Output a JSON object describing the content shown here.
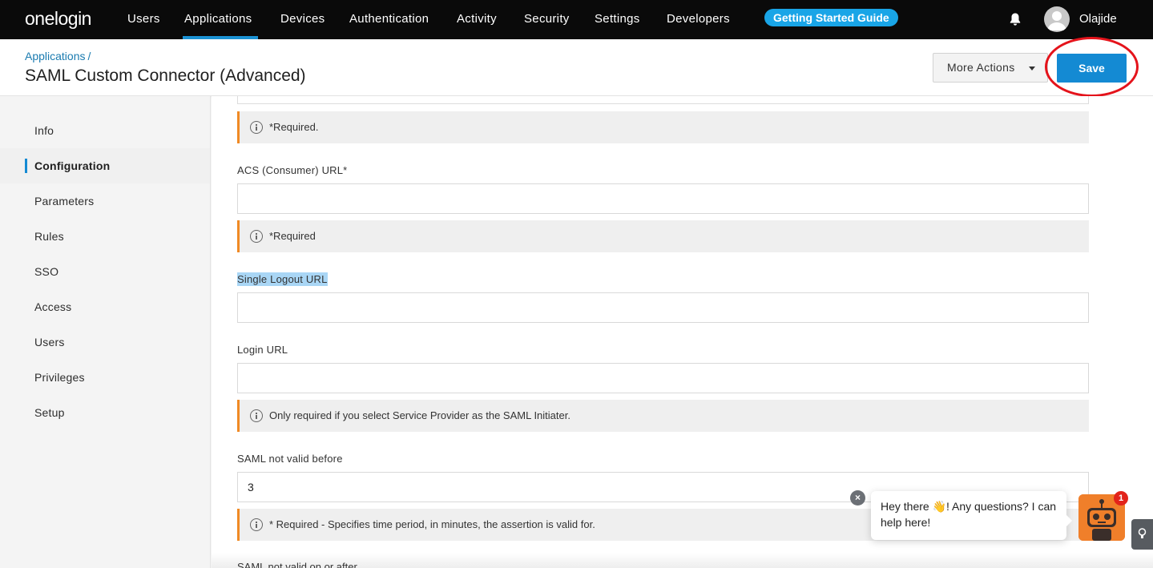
{
  "topnav": {
    "logo": "onelogin",
    "items": [
      "Users",
      "Applications",
      "Devices",
      "Authentication",
      "Activity",
      "Security",
      "Settings",
      "Developers"
    ],
    "active": "Applications",
    "guide_label": "Getting Started Guide",
    "username": "Olajide"
  },
  "header": {
    "breadcrumb": "Applications",
    "breadcrumb_sep": "/",
    "title": "SAML Custom Connector (Advanced)",
    "more_actions": "More Actions",
    "save": "Save"
  },
  "sidebar": {
    "items": [
      "Info",
      "Configuration",
      "Parameters",
      "Rules",
      "SSO",
      "Access",
      "Users",
      "Privileges",
      "Setup"
    ],
    "active": "Configuration"
  },
  "form": {
    "note_top": "*Required.",
    "acs_label": "ACS (Consumer) URL*",
    "acs_value": "",
    "acs_note": "*Required",
    "slo_label": "Single Logout URL",
    "slo_value": "",
    "login_label": "Login URL",
    "login_value": "",
    "login_note": "Only required if you select Service Provider as the SAML Initiater.",
    "nvb_label": "SAML not valid before",
    "nvb_value": "3",
    "nvb_note": "* Required - Specifies time period, in minutes, the assertion is valid for.",
    "nvoa_label": "SAML not valid on or after"
  },
  "chat": {
    "message_part1": "Hey there ",
    "message_part2": "! Any questions? I can help here!",
    "badge": "1",
    "close": "×"
  },
  "colors": {
    "accent": "#148ad3",
    "warning_border": "#f08a24",
    "annotation": "#e4131b",
    "bot": "#f07f2a"
  }
}
